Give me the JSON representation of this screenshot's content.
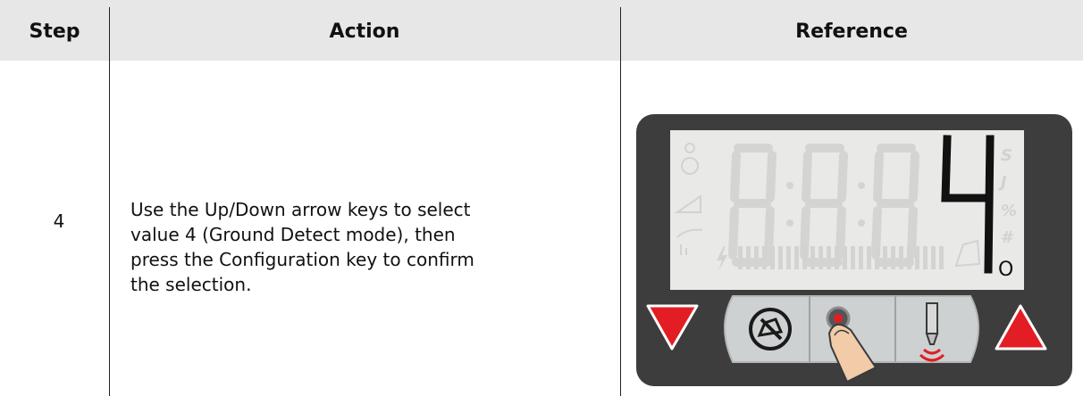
{
  "table": {
    "headers": {
      "step": "Step",
      "action": "Action",
      "reference": "Reference"
    },
    "rows": [
      {
        "step": "4",
        "action_lines": [
          "Use the Up/Down arrow keys to select",
          "value 4 (Ground Detect mode), then",
          "press the Configuration key to confirm",
          "the selection."
        ],
        "reference": {
          "display_value": "4",
          "indicator_symbol": "O",
          "unit_glyphs": [
            "S",
            "J",
            "%",
            "#"
          ],
          "icons": [
            "down-arrow-icon",
            "alarm-mute-icon",
            "configuration-key-icon",
            "probe-icon",
            "up-arrow-icon",
            "finger-icon"
          ]
        }
      }
    ]
  }
}
